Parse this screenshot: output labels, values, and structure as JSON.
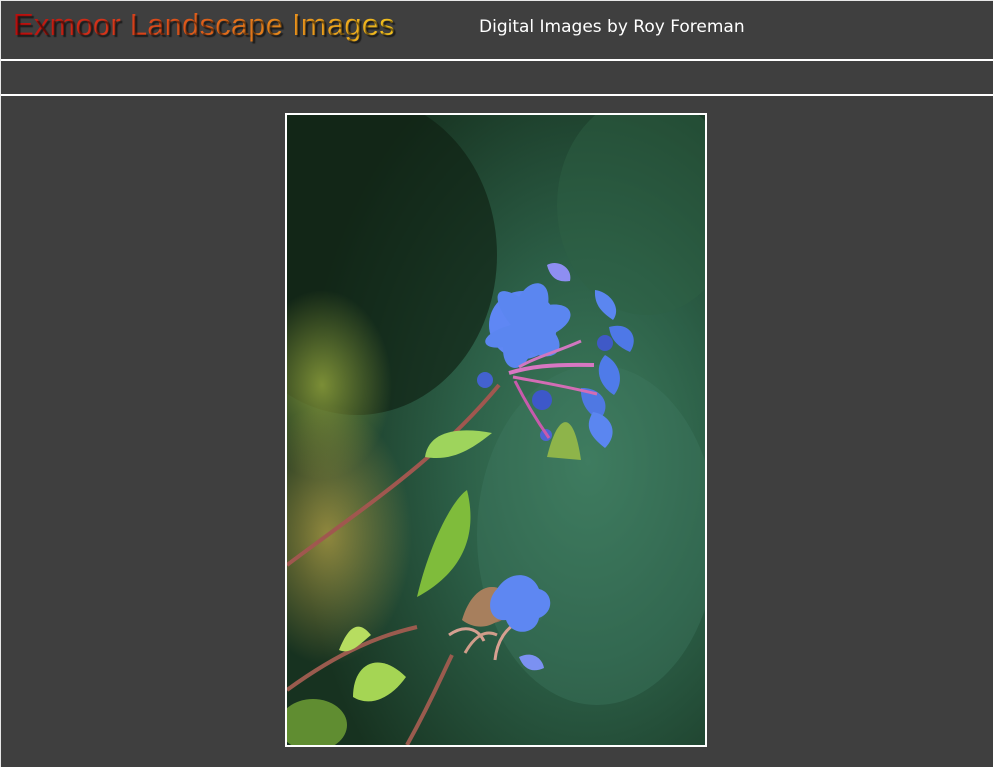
{
  "header": {
    "title": "Exmoor Landscape Images",
    "subtitle": "Digital Images by Roy Foreman"
  },
  "navbar": {
    "items": []
  },
  "photo": {
    "subject": "flower-photo",
    "colors": {
      "background": "#3f3f3f",
      "frame": "#ffffff",
      "petal": "#5b86f0",
      "foliage": "#1f4a24"
    }
  }
}
